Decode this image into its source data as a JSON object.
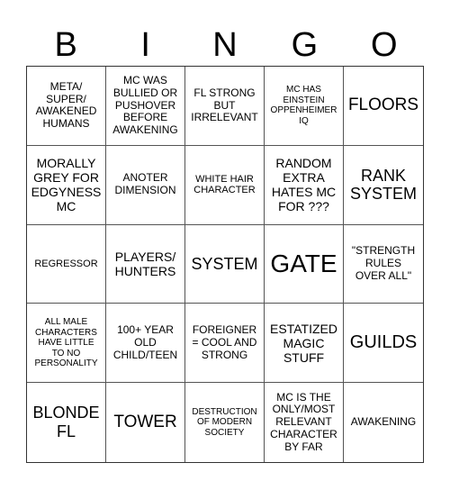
{
  "header": {
    "letters": [
      "B",
      "I",
      "N",
      "G",
      "O"
    ]
  },
  "cells": [
    "META/\nSUPER/\nAWAKENED\nHUMANS",
    "MC WAS\nBULLIED OR\nPUSHOVER\nBEFORE\nAWAKENING",
    "FL STRONG\nBUT\nIRRELEVANT",
    "MC HAS\nEINSTEIN\nOPPENHEIMER\nIQ",
    "FLOORS",
    "MORALLY\nGREY FOR\nEDGYNESS\nMC",
    "ANOTER\nDIMENSION",
    "WHITE HAIR\nCHARACTER",
    "RANDOM\nEXTRA\nHATES MC\nFOR ???",
    "RANK\nSYSTEM",
    "REGRESSOR",
    "PLAYERS/\nHUNTERS",
    "SYSTEM",
    "GATE",
    "\"STRENGTH\nRULES\nOVER ALL\"",
    "ALL MALE\nCHARACTERS\nHAVE LITTLE\nTO NO\nPERSONALITY",
    "100+ YEAR\nOLD\nCHILD/TEEN",
    "FOREIGNER\n= COOL AND\nSTRONG",
    "ESTATIZED\nMAGIC\nSTUFF",
    "GUILDS",
    "BLONDE\nFL",
    "TOWER",
    "DESTRUCTION\nOF MODERN\nSOCIETY",
    "MC IS THE\nONLY/MOST\nRELEVANT\nCHARACTER\nBY FAR",
    "AWAKENING"
  ]
}
